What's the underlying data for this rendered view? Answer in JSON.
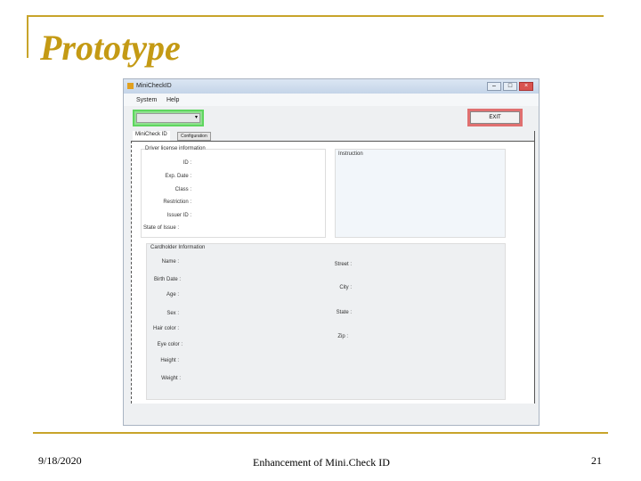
{
  "slide": {
    "title": "Prototype",
    "date": "9/18/2020",
    "footer": "Enhancement of Mini.Check ID",
    "page": "21"
  },
  "window": {
    "title": "MiniCheckID",
    "menu": [
      "System",
      "Help"
    ],
    "exit_label": "EXIT",
    "tabs": [
      "MiniCheck ID",
      "Configuration"
    ],
    "license_group": {
      "title": "Driver license information",
      "fields": [
        "ID :",
        "Exp. Date :",
        "Class :",
        "Restriction :",
        "Issuer ID :",
        "State of Issue :"
      ]
    },
    "instruction_group": {
      "title": "Instruction"
    },
    "cardholder_group": {
      "title": "Cardholder Information",
      "left_fields": [
        "Name :",
        "Birth Date :",
        "Age :",
        "Sex :",
        "Hair color :",
        "Eye color :",
        "Height :",
        "Weight :"
      ],
      "right_fields": [
        "Street :",
        "City :",
        "State :",
        "Zip :"
      ]
    }
  },
  "colors": {
    "accent": "#c8a42a",
    "combo_border": "#5ed65e",
    "exit_border": "#e07070"
  }
}
